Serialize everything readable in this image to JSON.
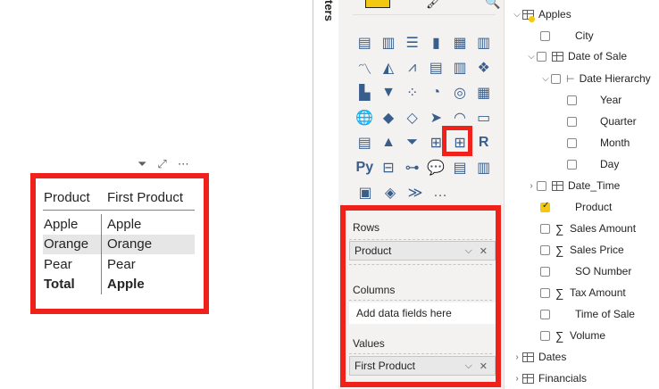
{
  "visual_header": {
    "filter_icon": "filter-icon",
    "focus_icon": "focus-mode-icon",
    "more_icon": "more-options-icon"
  },
  "matrix": {
    "headers": [
      "Product",
      "First Product"
    ],
    "rows": [
      [
        "Apple",
        "Apple"
      ],
      [
        "Orange",
        "Orange"
      ],
      [
        "Pear",
        "Pear"
      ]
    ],
    "total": [
      "Total",
      "Apple"
    ]
  },
  "filters": {
    "label": "ters"
  },
  "viz_pane": {
    "tabs": [
      "build-visual-tab",
      "format-visual-tab",
      "analytics-tab"
    ],
    "more_visuals": "…"
  },
  "wells": {
    "rows_label": "Rows",
    "rows_field": "Product",
    "columns_label": "Columns",
    "columns_placeholder": "Add data fields here",
    "values_label": "Values",
    "values_field": "First Product"
  },
  "fields": {
    "apples_table": "Apples",
    "city": "City",
    "date_of_sale": "Date of Sale",
    "date_hierarchy": "Date Hierarchy",
    "year": "Year",
    "quarter": "Quarter",
    "month": "Month",
    "day": "Day",
    "date_time": "Date_Time",
    "product": "Product",
    "sales_amount": "Sales Amount",
    "sales_price": "Sales Price",
    "so_number": "SO Number",
    "tax_amount": "Tax Amount",
    "time_of_sale": "Time of Sale",
    "volume": "Volume",
    "dates_table": "Dates",
    "financials_table": "Financials"
  },
  "colors": {
    "highlight_red": "#f0201a",
    "accent_blue": "#3a96dd",
    "pbi_yellow": "#f2c811"
  }
}
